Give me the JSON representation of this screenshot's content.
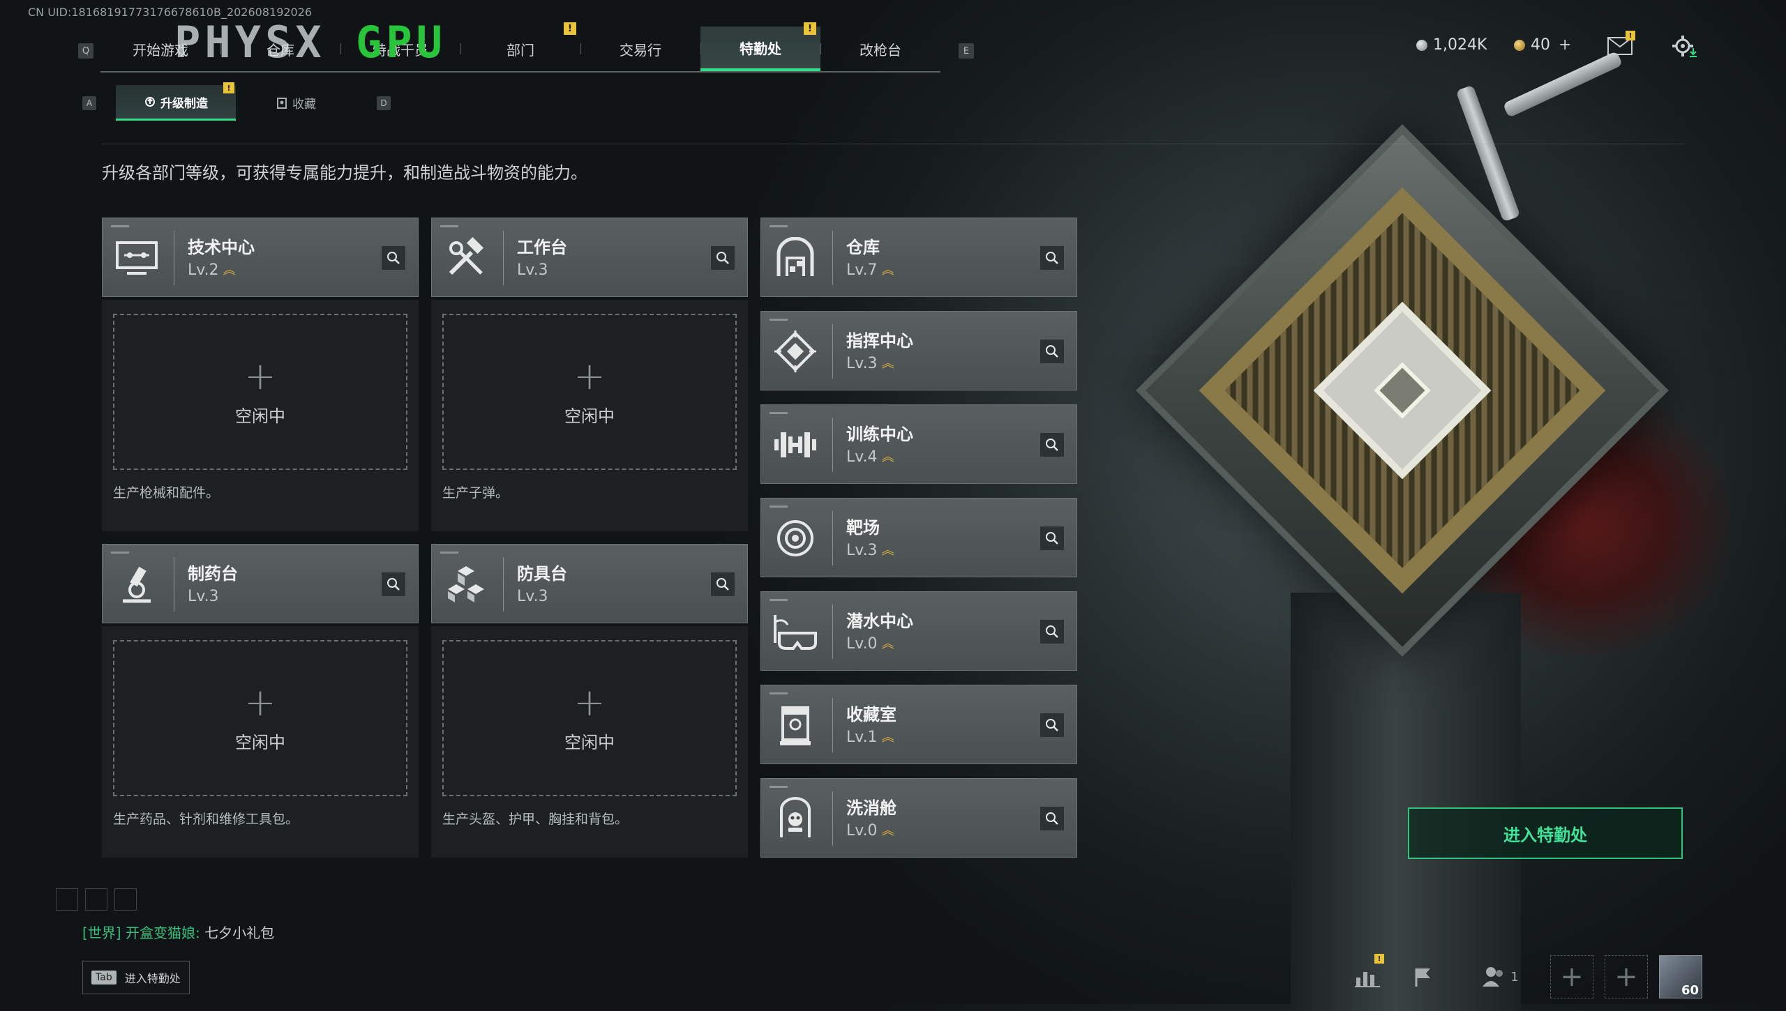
{
  "uid_text": "CN UID:18168191773176678610B_202608192026",
  "overlay": {
    "physx": "PHYSX",
    "gpu": "GPU"
  },
  "top_tabs": [
    {
      "key": "Q"
    },
    {
      "label": "开始游戏"
    },
    {
      "label": "仓库"
    },
    {
      "label": "特战干员"
    },
    {
      "label": "部门"
    },
    {
      "label": "交易行"
    },
    {
      "label": "特勤处",
      "active": true
    },
    {
      "label": "改枪台"
    },
    {
      "key": "E"
    }
  ],
  "alerts": {
    "bang": "!"
  },
  "currency": {
    "silver": "1,024K",
    "gold": "40",
    "gold_add": "+"
  },
  "sub_tabs": {
    "left_key": "A",
    "right_key": "D",
    "upgrade": "升级制造",
    "collection": "收藏"
  },
  "description": "升级各部门等级，可获得专属能力提升，和制造战斗物资的能力。",
  "production": [
    {
      "name": "技术中心",
      "level": "Lv.2",
      "upgradable": true,
      "slot": "空闲中",
      "note": "生产枪械和配件。"
    },
    {
      "name": "工作台",
      "level": "Lv.3",
      "upgradable": false,
      "slot": "空闲中",
      "note": "生产子弹。"
    },
    {
      "name": "制药台",
      "level": "Lv.3",
      "upgradable": false,
      "slot": "空闲中",
      "note": "生产药品、针剂和维修工具包。"
    },
    {
      "name": "防具台",
      "level": "Lv.3",
      "upgradable": false,
      "slot": "空闲中",
      "note": "生产头盔、护甲、胸挂和背包。"
    }
  ],
  "facilities": [
    {
      "name": "仓库",
      "level": "Lv.7"
    },
    {
      "name": "指挥中心",
      "level": "Lv.3"
    },
    {
      "name": "训练中心",
      "level": "Lv.4"
    },
    {
      "name": "靶场",
      "level": "Lv.3"
    },
    {
      "name": "潜水中心",
      "level": "Lv.0"
    },
    {
      "name": "收藏室",
      "level": "Lv.1"
    },
    {
      "name": "洗消舱",
      "level": "Lv.0"
    }
  ],
  "enter_button": "进入特勤处",
  "chat": {
    "channel": "[世界]",
    "sender": "开盒变猫娘:",
    "message": "七夕小礼包"
  },
  "tab_hint": {
    "key": "Tab",
    "label": "进入特勤处"
  },
  "bottom": {
    "party_count": "1",
    "player_level": "60"
  },
  "colors": {
    "accent": "#2fdc8a",
    "alert": "#e9c33a",
    "upgrade_arrow": "#e3b33e",
    "physx_green": "#28c43a"
  }
}
